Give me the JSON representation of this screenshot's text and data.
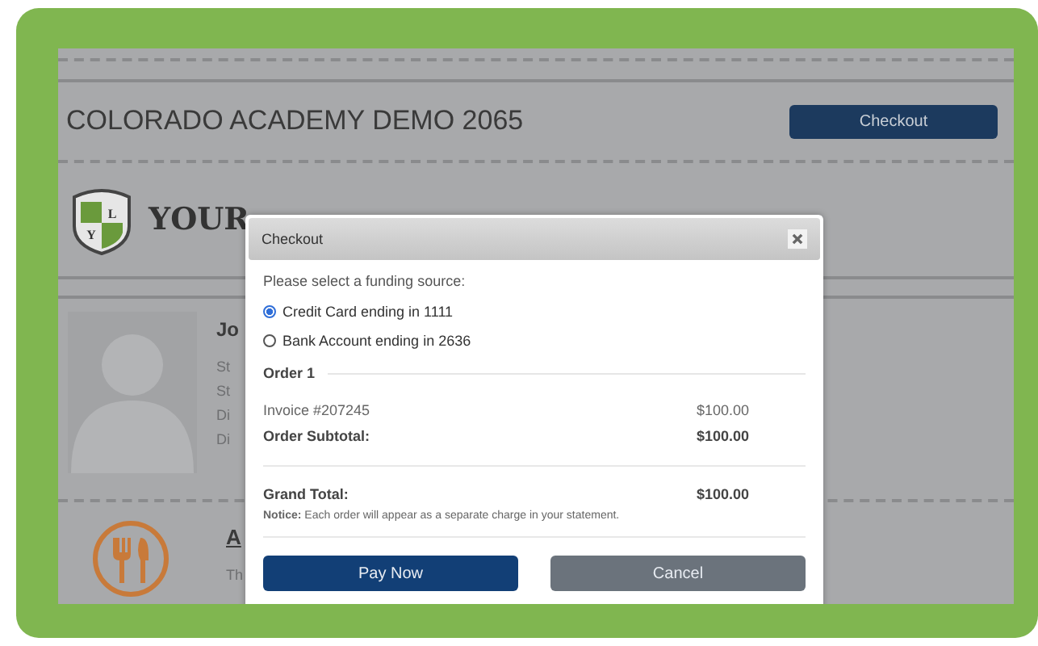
{
  "page": {
    "title": "COLORADO ACADEMY DEMO 2065",
    "checkout_button": "Checkout",
    "brand": "YOUR",
    "logo_letters": [
      "L",
      "Y"
    ],
    "profile": {
      "name": "Jo",
      "lines": [
        "St",
        "St",
        "Di",
        "Di"
      ]
    },
    "item": {
      "title": "A",
      "text": "Th"
    }
  },
  "dialog": {
    "title": "Checkout",
    "prompt": "Please select a funding source:",
    "sources": [
      {
        "label": "Credit Card ending in 1111",
        "selected": true
      },
      {
        "label": "Bank Account ending in 2636",
        "selected": false
      }
    ],
    "order_heading": "Order 1",
    "lines": [
      {
        "label": "Invoice #207245",
        "amount": "$100.00",
        "kind": "item"
      },
      {
        "label": "Order Subtotal:",
        "amount": "$100.00",
        "kind": "subtotal"
      }
    ],
    "grand_total": {
      "label": "Grand Total:",
      "amount": "$100.00"
    },
    "notice": "**Notice:** Each order will appear as a separate charge in your statement.",
    "buttons": [
      {
        "label": "Pay Now",
        "kind": "primary"
      },
      {
        "label": "Cancel",
        "kind": "secondary"
      }
    ]
  }
}
